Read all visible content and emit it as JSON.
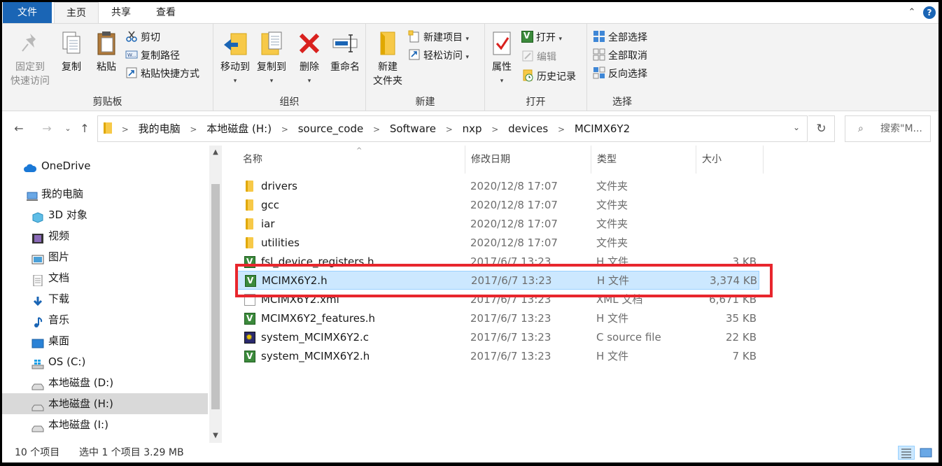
{
  "tabs": {
    "file": "文件",
    "home": "主页",
    "share": "共享",
    "view": "查看"
  },
  "ribbon": {
    "clipboard": {
      "label": "剪贴板",
      "pin_line1": "固定到",
      "pin_line2": "快速访问",
      "copy": "复制",
      "paste": "粘贴",
      "cut": "剪切",
      "copy_path": "复制路径",
      "paste_shortcut": "粘贴快捷方式"
    },
    "organize": {
      "label": "组织",
      "move_to": "移动到",
      "copy_to": "复制到",
      "delete": "删除",
      "rename": "重命名"
    },
    "new": {
      "label": "新建",
      "new_folder_line1": "新建",
      "new_folder_line2": "文件夹",
      "new_item": "新建项目",
      "easy_access": "轻松访问"
    },
    "open": {
      "label": "打开",
      "properties": "属性",
      "open": "打开",
      "edit": "编辑",
      "history": "历史记录"
    },
    "select": {
      "label": "选择",
      "select_all": "全部选择",
      "select_none": "全部取消",
      "invert": "反向选择"
    }
  },
  "address": {
    "crumbs": [
      "我的电脑",
      "本地磁盘 (H:)",
      "source_code",
      "Software",
      "nxp",
      "devices",
      "MCIMX6Y2"
    ],
    "search_placeholder": "搜索\"M..."
  },
  "nav": {
    "items": [
      {
        "label": "OneDrive",
        "icon": "cloud-icon"
      },
      {
        "label": "我的电脑",
        "icon": "computer-icon"
      },
      {
        "label": "3D 对象",
        "icon": "cube-icon"
      },
      {
        "label": "视频",
        "icon": "video-icon"
      },
      {
        "label": "图片",
        "icon": "picture-icon"
      },
      {
        "label": "文档",
        "icon": "document-icon"
      },
      {
        "label": "下载",
        "icon": "download-icon"
      },
      {
        "label": "音乐",
        "icon": "music-icon"
      },
      {
        "label": "桌面",
        "icon": "desktop-icon"
      },
      {
        "label": "OS (C:)",
        "icon": "windows-drive-icon"
      },
      {
        "label": "本地磁盘 (D:)",
        "icon": "drive-icon"
      },
      {
        "label": "本地磁盘 (H:)",
        "icon": "drive-icon"
      },
      {
        "label": "本地磁盘 (I:)",
        "icon": "drive-icon"
      }
    ]
  },
  "columns": {
    "name": "名称",
    "date": "修改日期",
    "type": "类型",
    "size": "大小"
  },
  "files": [
    {
      "name": "drivers",
      "date": "2020/12/8 17:07",
      "type": "文件夹",
      "size": "",
      "icon": "folder-icon"
    },
    {
      "name": "gcc",
      "date": "2020/12/8 17:07",
      "type": "文件夹",
      "size": "",
      "icon": "folder-icon"
    },
    {
      "name": "iar",
      "date": "2020/12/8 17:07",
      "type": "文件夹",
      "size": "",
      "icon": "folder-icon"
    },
    {
      "name": "utilities",
      "date": "2020/12/8 17:07",
      "type": "文件夹",
      "size": "",
      "icon": "folder-icon"
    },
    {
      "name": "fsl_device_registers.h",
      "date": "2017/6/7 13:23",
      "type": "H 文件",
      "size": "3 KB",
      "icon": "h-file-icon"
    },
    {
      "name": "MCIMX6Y2.h",
      "date": "2017/6/7 13:23",
      "type": "H 文件",
      "size": "3,374 KB",
      "icon": "h-file-icon"
    },
    {
      "name": "MCIMX6Y2.xml",
      "date": "2017/6/7 13:23",
      "type": "XML 文档",
      "size": "6,671 KB",
      "icon": "xml-file-icon"
    },
    {
      "name": "MCIMX6Y2_features.h",
      "date": "2017/6/7 13:23",
      "type": "H 文件",
      "size": "35 KB",
      "icon": "h-file-icon"
    },
    {
      "name": "system_MCIMX6Y2.c",
      "date": "2017/6/7 13:23",
      "type": "C source file",
      "size": "22 KB",
      "icon": "c-file-icon"
    },
    {
      "name": "system_MCIMX6Y2.h",
      "date": "2017/6/7 13:23",
      "type": "H 文件",
      "size": "7 KB",
      "icon": "h-file-icon"
    }
  ],
  "status": {
    "count": "10 个项目",
    "selection": "选中 1 个项目  3.29 MB"
  },
  "colors": {
    "accent": "#1a65b5",
    "selection": "#cce8ff",
    "highlight_box": "#e8262d"
  }
}
